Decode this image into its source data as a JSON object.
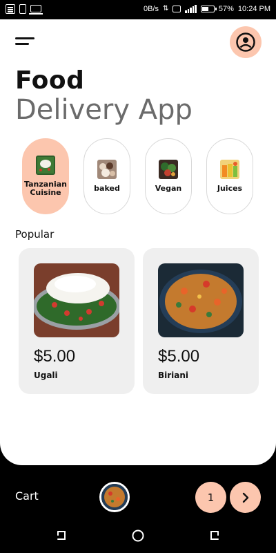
{
  "status_bar": {
    "net_speed": "0B/s",
    "battery": "57%",
    "time": "10:24 PM"
  },
  "header": {
    "menu_icon": "hamburger-menu-icon",
    "profile_icon": "user-circle-icon",
    "title_bold": "Food",
    "title_light": "Delivery App"
  },
  "categories": [
    {
      "label": "Tanzanian Cuisine",
      "active": true
    },
    {
      "label": "baked",
      "active": false
    },
    {
      "label": "Vegan",
      "active": false
    },
    {
      "label": "Juices",
      "active": false
    }
  ],
  "popular": {
    "title": "Popular",
    "items": [
      {
        "price": "$5.00",
        "name": "Ugali"
      },
      {
        "price": "$5.00",
        "name": "Biriani"
      }
    ]
  },
  "cart": {
    "label": "Cart",
    "count": "1"
  },
  "colors": {
    "accent": "#fcc6ae",
    "card_bg": "#efefef",
    "title_light": "#6b6b6b"
  }
}
